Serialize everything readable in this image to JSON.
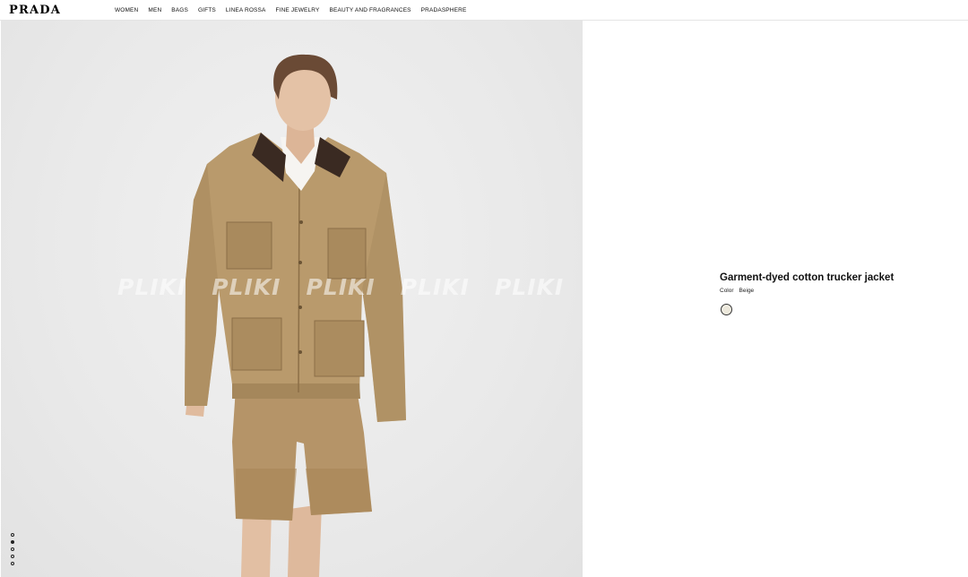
{
  "header": {
    "logo": "PRADA",
    "nav": [
      "WOMEN",
      "MEN",
      "BAGS",
      "GIFTS",
      "LINEA ROSSA",
      "FINE JEWELRY",
      "BEAUTY AND FRAGRANCES",
      "PRADASPHERE"
    ]
  },
  "gallery": {
    "watermark_text": "PLIKI",
    "slide_count": 5,
    "active_slide": 2
  },
  "product": {
    "title": "Garment-dyed cotton trucker jacket",
    "color_label": "Color",
    "color_value": "Beige",
    "swatch_color": "#ece8db"
  },
  "colors": {
    "jacket": "#b99a6c",
    "collar": "#3a2a22",
    "background": "#ebebeb"
  }
}
